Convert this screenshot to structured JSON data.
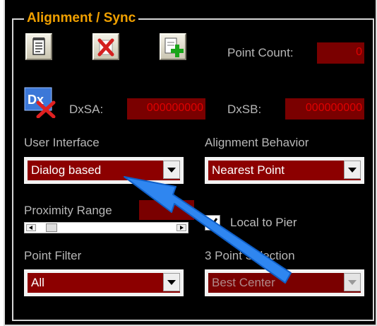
{
  "group": {
    "title": "Alignment / Sync"
  },
  "toolbar": {
    "buttons": [
      {
        "icon": "notepad-icon"
      },
      {
        "icon": "delete-x-icon"
      },
      {
        "icon": "add-plus-icon"
      }
    ]
  },
  "point_count": {
    "label": "Point Count:",
    "value": "0"
  },
  "dx": {
    "icon": "dx-clear-icon",
    "sa_label": "DxSA:",
    "sa_value": "000000000",
    "sb_label": "DxSB:",
    "sb_value": "000000000"
  },
  "user_interface": {
    "label": "User Interface",
    "value": "Dialog based"
  },
  "alignment_behavior": {
    "label": "Alignment Behavior",
    "value": "Nearest Point"
  },
  "proximity_range": {
    "label": "Proximity Range",
    "value": "0"
  },
  "local_to_pier": {
    "label": "Local to Pier",
    "checked": true
  },
  "point_filter": {
    "label": "Point Filter",
    "value": "All"
  },
  "three_point_selection": {
    "label": "3 Point Selection",
    "value": "Best Center",
    "disabled": true
  },
  "colors": {
    "panel_bg": "#000000",
    "group_title": "#f0a000",
    "label": "#b7b7b7",
    "field_bg": "#8c0000",
    "field_text_red": "#e00000",
    "annotation_arrow": "#2f86f0"
  }
}
